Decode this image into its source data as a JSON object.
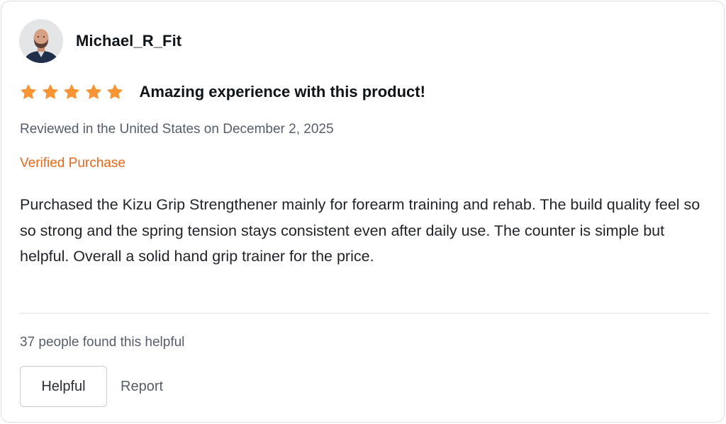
{
  "review": {
    "username": "Michael_R_Fit",
    "avatar_icon": "user-avatar-photo",
    "rating": 5,
    "rating_max": 5,
    "star_color": "#f79433",
    "title": "Amazing experience with this product!",
    "reviewed_line": "Reviewed in the United States on December 2, 2025",
    "verified_label": "Verified Purchase",
    "verified_color": "#e8681a",
    "body": "Purchased the Kizu Grip Strengthener mainly for forearm training and rehab. The build quality feel so so strong and the spring tension stays consistent even after daily use. The counter is simple but helpful. Overall a solid hand grip trainer for the price.",
    "helpful_count_text": "37 people found this helpful"
  },
  "actions": {
    "helpful_label": "Helpful",
    "report_label": "Report"
  }
}
